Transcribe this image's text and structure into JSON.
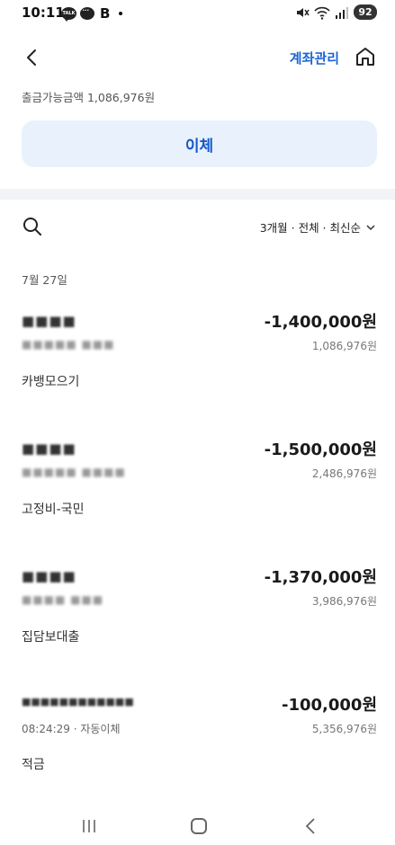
{
  "status_bar": {
    "time": "10:11",
    "talk_label": "TALK",
    "b_label": "B",
    "battery": "92"
  },
  "header": {
    "account_manage_label": "계좌관리"
  },
  "summary": {
    "withdrawable_label": "출금가능금액 1,086,976원"
  },
  "transfer_button_label": "이체",
  "filter_label": "3개월 · 전체 · 최신순",
  "date_header": "7월 27일",
  "transactions": [
    {
      "name": "■■■■",
      "amount": "-1,400,000원",
      "sub": "■■■■■  ■■■",
      "balance": "1,086,976원",
      "memo": "카뱅모으기"
    },
    {
      "name": "■■■■",
      "amount": "-1,500,000원",
      "sub": "■■■■■ ■■■■",
      "balance": "2,486,976원",
      "memo": "고정비-국민"
    },
    {
      "name": "■■■■",
      "amount": "-1,370,000원",
      "sub": "■■■■   ■■■",
      "balance": "3,986,976원",
      "memo": "집담보대출"
    },
    {
      "name": "■■■■■■■■■■■■",
      "amount": "-100,000원",
      "sub": "08:24:29 · 자동이체",
      "balance": "5,356,976원",
      "memo": "적금"
    }
  ]
}
